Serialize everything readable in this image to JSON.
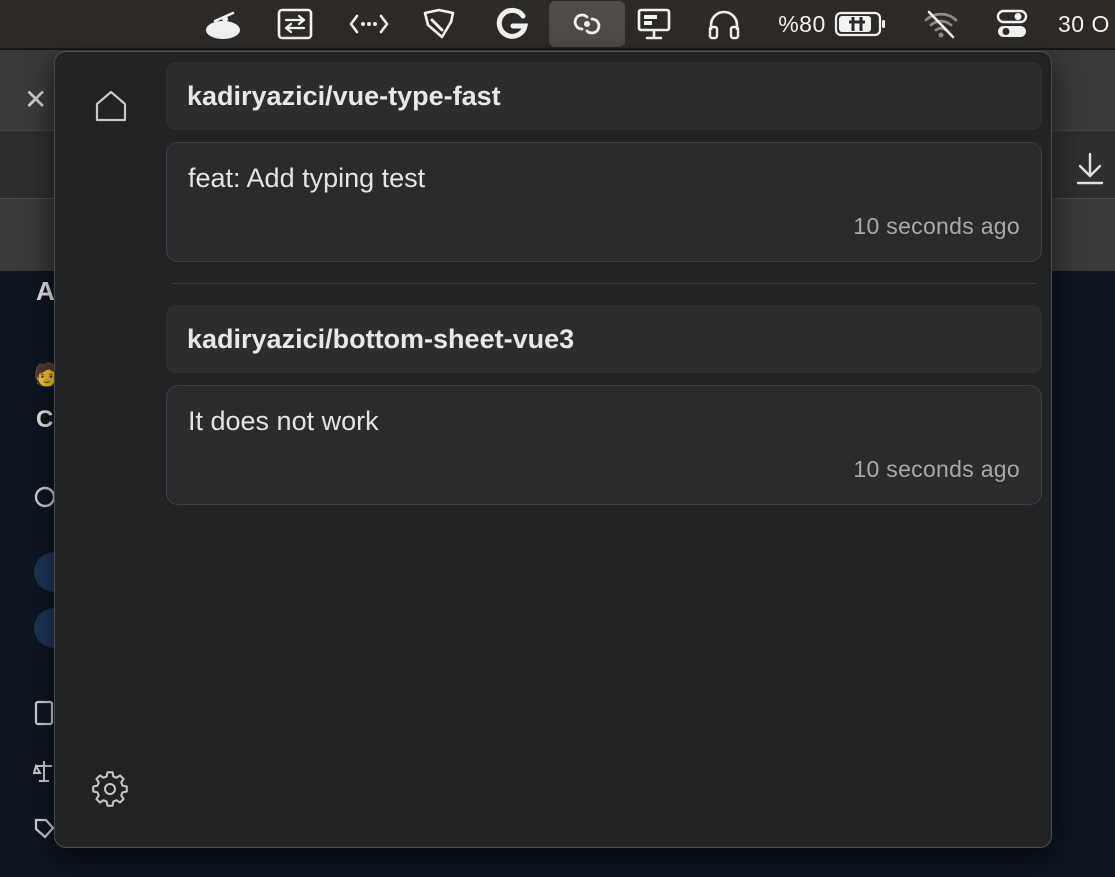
{
  "menubar": {
    "icons": [
      "cloud-dish-icon",
      "remote-desktop-icon",
      "code-arrows-icon",
      "shield-pen-icon",
      "grammarly-g-icon",
      "git-link-icon",
      "monitor-icon",
      "headphones-icon",
      "battery-icon",
      "wifi-off-icon",
      "control-center-icon"
    ],
    "battery_text": "%80",
    "clock_text": "30 O",
    "active_item": "git-link-icon"
  },
  "background": {
    "letters": [
      "A",
      "C"
    ]
  },
  "panel": {
    "nav_icons": [
      "home-icon",
      "gear-icon"
    ],
    "groups": [
      {
        "repo": "kadiryazici/vue-type-fast",
        "notifications": [
          {
            "title": "feat: Add typing test",
            "time": "10 seconds ago"
          }
        ]
      },
      {
        "repo": "kadiryazici/bottom-sheet-vue3",
        "notifications": [
          {
            "title": "It does not work",
            "time": "10 seconds ago"
          }
        ]
      }
    ]
  }
}
